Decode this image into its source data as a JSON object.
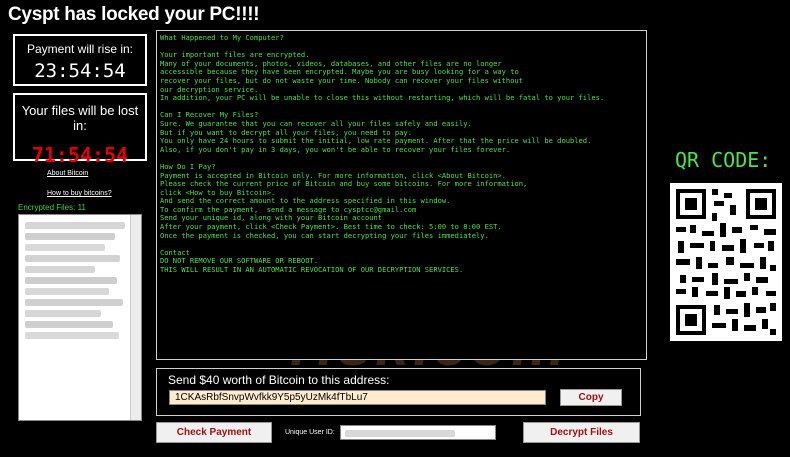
{
  "title": "Cyspt has locked your PC!!!!",
  "timer1": {
    "label": "Payment will rise in:",
    "value": "23:54:54"
  },
  "timer2": {
    "label": "Your files will be lost in:",
    "value": "71:54:54"
  },
  "links": {
    "about_bitcoin": "About Bitcoin",
    "how_to_buy": "How to buy bitcoins?"
  },
  "encrypted": {
    "label": "Encrypted Files:  11"
  },
  "message": "What Happened to My Computer?\n\nYour important files are encrypted.\nMany of your documents, photos, videos, databases, and other files are no longer\naccessible because they have been encrypted. Maybe you are busy looking for a way to\nrecover your files, but do not waste your time. Nobody can recover your files without\nour decryption service.\nIn addition, your PC will be unable to close this without restarting, which will be fatal to your files.\n\nCan I Recover My Files?\nSure. We guarantee that you can recover all your files safely and easily.\nBut if you want to decrypt all your files, you need to pay.\nYou only have 24 hours to submit the initial, low rate payment. After that the price will be doubled.\nAlso, if you don't pay in 3 days, you won't be able to recover your files forever.\n\nHow Do I Pay?\nPayment is accepted in Bitcoin only. For more information, click <About Bitcoin>.\nPlease check the current price of Bitcoin and buy some bitcoins. For more information,\nclick <How to buy Bitcoin>.\nAnd send the correct amount to the address specified in this window.\nTo confirm the payment,  send a message to cysptcc@gmail.com\nSend your unique id, along with your Bitcoin account\nAfter your payment, click <Check Payment>. Best time to check: 5:00 to 8:00 EST.\nOnce the payment is checked, you can start decrypting your files immediately.\n\nContact\nDO NOT REMOVE OUR SOFTWARE OR REBOOT.\nTHIS WILL RESULT IN AN AUTOMATIC REVOCATION OF OUR DECRYPTION SERVICES.",
  "qr": {
    "label": "QR CODE:"
  },
  "send": {
    "label": "Send $40 worth of Bitcoin to this address:",
    "address": "1CKAsRbfSnvpWvfkk9Y5p5yUzMk4fTbLu7",
    "copy_label": "Copy"
  },
  "buttons": {
    "check_payment": "Check Payment",
    "decrypt_files": "Decrypt Files"
  },
  "uid": {
    "label": "Unique User ID:"
  },
  "colors": {
    "terminal_green": "#4ee04e",
    "timer_red": "#e00000",
    "button_text": "#a01010",
    "address_bg": "#ffeccf"
  }
}
